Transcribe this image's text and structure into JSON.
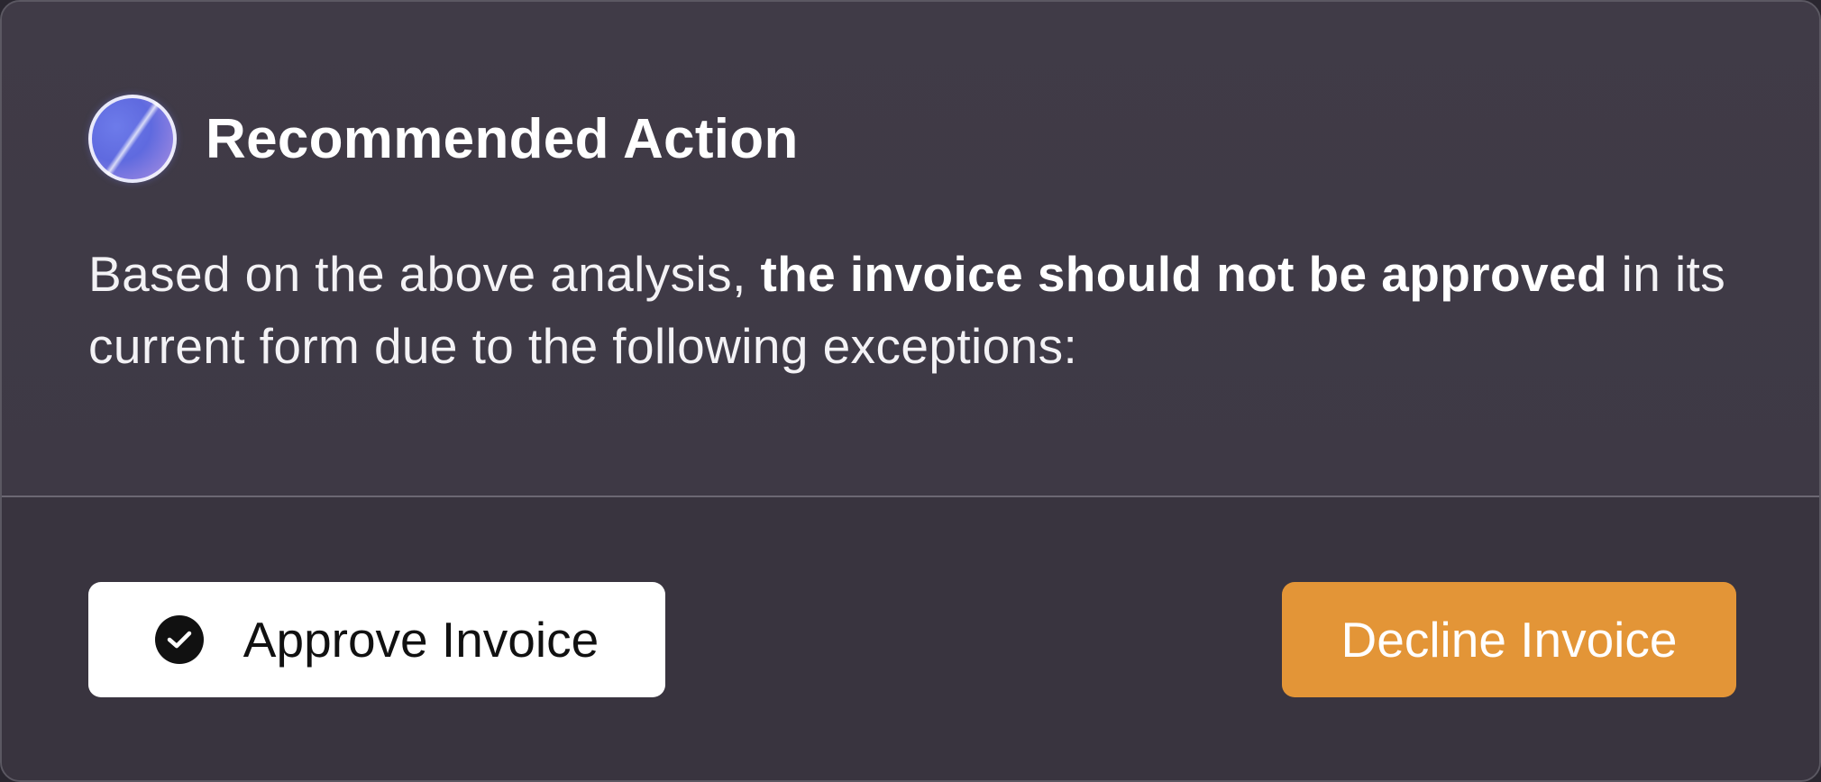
{
  "card": {
    "title": "Recommended Action",
    "description": {
      "before": "Based on the above analysis, ",
      "emphasis": "the invoice should not be approved",
      "after": " in its current form due to the following exceptions:"
    },
    "icons": {
      "header": "ai-orb-icon",
      "approve": "check-circle-icon"
    }
  },
  "actions": {
    "approve_label": "Approve Invoice",
    "decline_label": "Decline Invoice"
  },
  "colors": {
    "card_background": "#3e3945",
    "footer_background": "#39343f",
    "approve_background": "#ffffff",
    "decline_background": "#e39537",
    "orb_primary": "#5f6adf"
  }
}
